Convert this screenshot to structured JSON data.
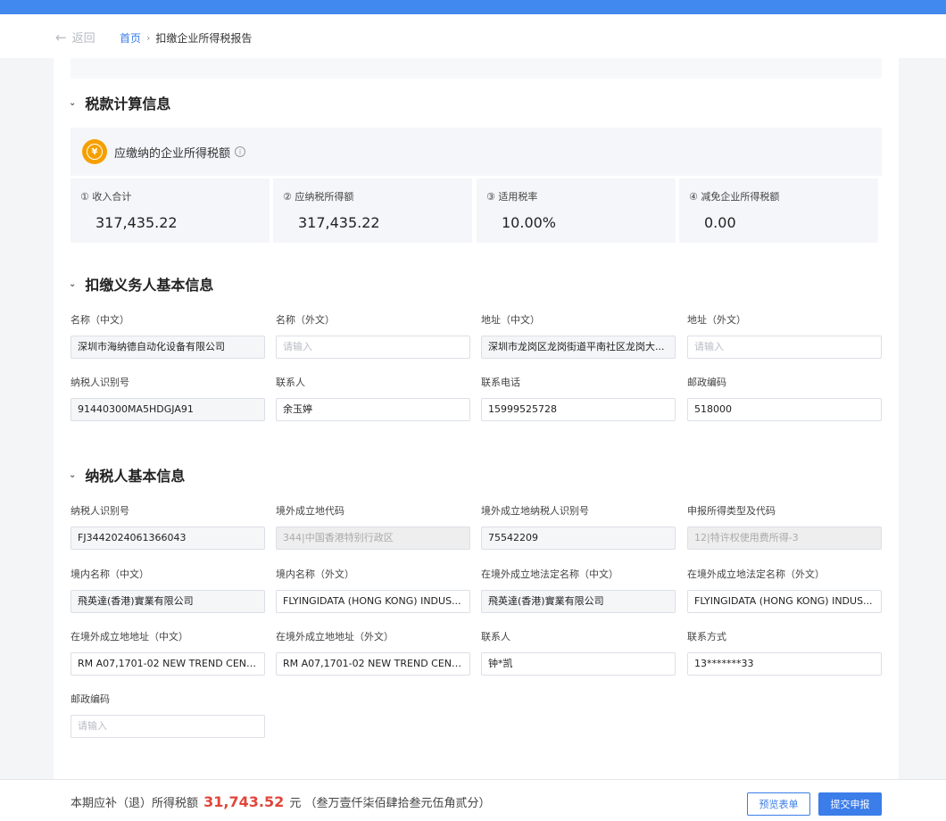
{
  "nav": {
    "back_label": "返回",
    "breadcrumb_home": "首页",
    "breadcrumb_current": "扣缴企业所得税报告"
  },
  "tax_calc": {
    "title": "税款计算信息",
    "header_title": "应缴纳的企业所得税额",
    "stats": [
      {
        "label": "① 收入合计",
        "value": "317,435.22"
      },
      {
        "label": "② 应纳税所得额",
        "value": "317,435.22"
      },
      {
        "label": "③ 适用税率",
        "value": "10.00%"
      },
      {
        "label": "④ 减免企业所得税额",
        "value": "0.00"
      }
    ]
  },
  "withholder": {
    "title": "扣缴义务人基本信息",
    "fields": [
      {
        "label": "名称（中文）",
        "value": "深圳市海纳德自动化设备有限公司",
        "placeholder": "",
        "style": "ro"
      },
      {
        "label": "名称（外文）",
        "value": "",
        "placeholder": "请输入",
        "style": ""
      },
      {
        "label": "地址（中文）",
        "value": "深圳市龙岗区龙岗街道平南社区龙岗大...",
        "placeholder": "",
        "style": "ro"
      },
      {
        "label": "地址（外文）",
        "value": "",
        "placeholder": "请输入",
        "style": ""
      },
      {
        "label": "纳税人识别号",
        "value": "91440300MA5HDGJA91",
        "placeholder": "",
        "style": "ro"
      },
      {
        "label": "联系人",
        "value": "余玉婷",
        "placeholder": "",
        "style": ""
      },
      {
        "label": "联系电话",
        "value": "15999525728",
        "placeholder": "",
        "style": ""
      },
      {
        "label": "邮政编码",
        "value": "518000",
        "placeholder": "",
        "style": ""
      }
    ]
  },
  "taxpayer": {
    "title": "纳税人基本信息",
    "fields": [
      {
        "label": "纳税人识别号",
        "value": "FJ3442024061366043",
        "placeholder": "",
        "style": "ro"
      },
      {
        "label": "境外成立地代码",
        "value": "344|中国香港特别行政区",
        "placeholder": "",
        "style": "dis"
      },
      {
        "label": "境外成立地纳税人识别号",
        "value": "75542209",
        "placeholder": "",
        "style": "ro"
      },
      {
        "label": "申报所得类型及代码",
        "value": "12|特许权使用费所得-3",
        "placeholder": "",
        "style": "dis"
      },
      {
        "label": "境内名称（中文）",
        "value": "飛英達(香港)實業有限公司",
        "placeholder": "",
        "style": "ro"
      },
      {
        "label": "境内名称（外文）",
        "value": "FLYINGIDATA (HONG KONG) INDUS...",
        "placeholder": "",
        "style": ""
      },
      {
        "label": "在境外成立地法定名称（中文）",
        "value": "飛英達(香港)實業有限公司",
        "placeholder": "",
        "style": "ro"
      },
      {
        "label": "在境外成立地法定名称（外文）",
        "value": "FLYINGIDATA (HONG KONG) INDUS...",
        "placeholder": "",
        "style": ""
      },
      {
        "label": "在境外成立地地址（中文）",
        "value": "RM A07,1701-02 NEW TREND CENT...",
        "placeholder": "",
        "style": ""
      },
      {
        "label": "在境外成立地地址（外文）",
        "value": "RM A07,1701-02 NEW TREND CENT...",
        "placeholder": "",
        "style": ""
      },
      {
        "label": "联系人",
        "value": "钟*凯",
        "placeholder": "",
        "style": ""
      },
      {
        "label": "联系方式",
        "value": "13*******33",
        "placeholder": "",
        "style": ""
      },
      {
        "label": "邮政编码",
        "value": "",
        "placeholder": "请输入",
        "style": ""
      }
    ]
  },
  "footer": {
    "prefix": "本期应补（退）所得税额",
    "amount": "31,743.52",
    "unit": "元",
    "amount_words": "（叁万壹仟柒佰肆拾叁元伍角贰分）",
    "preview_label": "预览表单",
    "submit_label": "提交申报"
  }
}
